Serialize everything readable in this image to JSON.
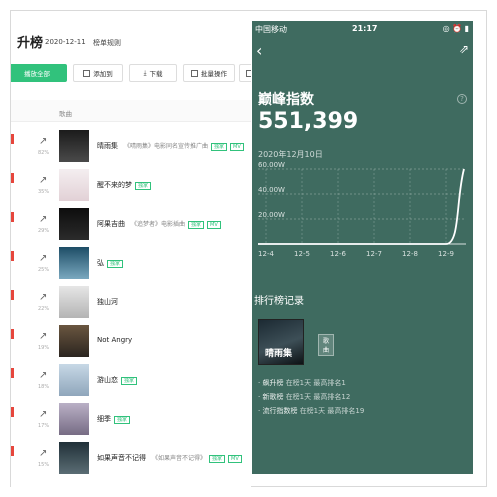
{
  "left": {
    "title": "升榜",
    "date": "2020-12-11",
    "rule_link": "榜单规则",
    "toolbar": {
      "play_all": "播放全部",
      "add_to": "添加到",
      "download": "下载",
      "batch": "批量操作"
    },
    "header": {
      "song_col": "歌曲"
    },
    "rows": [
      {
        "pct": "82%",
        "song": "晴雨集",
        "desc": "《晴雨集》电影同名宣传推广曲",
        "tags": [
          "独家",
          "MV"
        ]
      },
      {
        "pct": "35%",
        "song": "醒不来的梦",
        "desc": "",
        "tags": [
          "独家"
        ]
      },
      {
        "pct": "29%",
        "song": "阿果吉曲",
        "desc": "《追梦者》电影插曲",
        "tags": [
          "独家",
          "MV"
        ]
      },
      {
        "pct": "25%",
        "song": "弘",
        "desc": "",
        "tags": [
          "独家"
        ]
      },
      {
        "pct": "22%",
        "song": "独山河",
        "desc": "",
        "tags": []
      },
      {
        "pct": "19%",
        "song": "Not Angry",
        "desc": "",
        "tags": []
      },
      {
        "pct": "18%",
        "song": "游山恋",
        "desc": "",
        "tags": [
          "独家"
        ]
      },
      {
        "pct": "17%",
        "song": "细季",
        "desc": "",
        "tags": [
          "独家"
        ]
      },
      {
        "pct": "15%",
        "song": "如果声音不记得",
        "desc": "《如果声音不记得》",
        "tags": [
          "独家",
          "MV"
        ]
      }
    ]
  },
  "right": {
    "status": {
      "carrier": "中国移动",
      "time": "21:17"
    },
    "peak_label": "巅峰指数",
    "peak_value": "551,399",
    "chart_date": "2020年12月10日",
    "rank_heading": "排行榜记录",
    "genre_tag": "歌曲",
    "cover_text": "晴雨集",
    "records": [
      {
        "name": "飙升榜",
        "detail": "在榜1天 最高排名1"
      },
      {
        "name": "新歌榜",
        "detail": "在榜1天 最高排名12"
      },
      {
        "name": "流行指数榜",
        "detail": "在榜1天 最高排名19"
      }
    ]
  },
  "chart_data": {
    "type": "line",
    "categories": [
      "12-4",
      "12-5",
      "12-6",
      "12-7",
      "12-8",
      "12-9"
    ],
    "y_ticks": [
      "60.00W",
      "40.00W",
      "20.00W"
    ],
    "series": [
      {
        "values": [
          0,
          0,
          0,
          0,
          0,
          0,
          60.0
        ]
      }
    ],
    "ylim": [
      0,
      60
    ],
    "color": "#ffffff"
  }
}
